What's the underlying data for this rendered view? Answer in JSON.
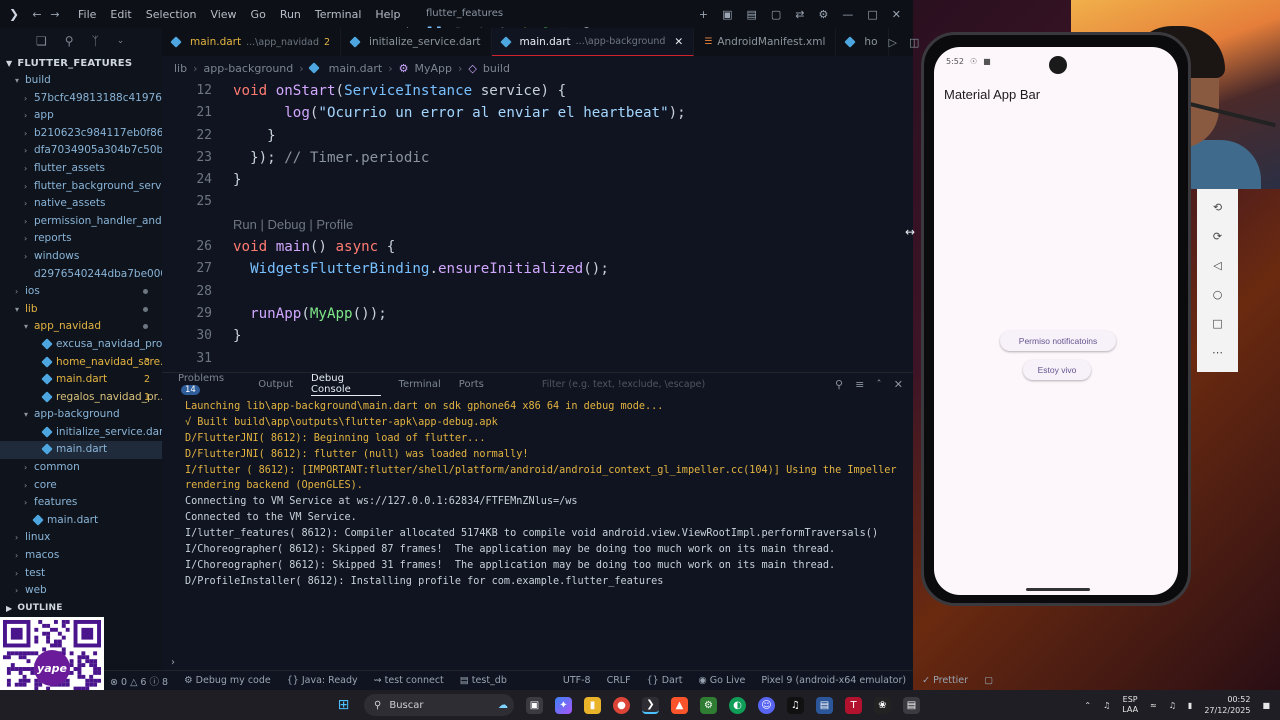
{
  "window": {
    "title": "flutter_features",
    "menu": [
      "File",
      "Edit",
      "Selection",
      "View",
      "Go",
      "Run",
      "Terminal",
      "Help"
    ]
  },
  "sidebar": {
    "section_title": "FLUTTER_FEATURES",
    "items": [
      {
        "label": "build",
        "kind": "folder",
        "open": true,
        "depth": 1,
        "color": "folder"
      },
      {
        "label": "57bcfc49813188c419766...",
        "kind": "folder",
        "depth": 2,
        "color": "folder"
      },
      {
        "label": "app",
        "kind": "folder",
        "depth": 2,
        "color": "folder"
      },
      {
        "label": "b210623c984117eb0f86f3...",
        "kind": "folder",
        "depth": 2,
        "color": "folder"
      },
      {
        "label": "dfa7034905a304b7c50be...",
        "kind": "folder",
        "depth": 2,
        "color": "folder"
      },
      {
        "label": "flutter_assets",
        "kind": "folder",
        "depth": 2,
        "color": "folder"
      },
      {
        "label": "flutter_background_servic...",
        "kind": "folder",
        "depth": 2,
        "color": "folder"
      },
      {
        "label": "native_assets",
        "kind": "folder",
        "depth": 2,
        "color": "folder"
      },
      {
        "label": "permission_handler_andr...",
        "kind": "folder",
        "depth": 2,
        "color": "folder"
      },
      {
        "label": "reports",
        "kind": "folder",
        "depth": 2,
        "color": "folder"
      },
      {
        "label": "windows",
        "kind": "folder",
        "depth": 2,
        "color": "folder"
      },
      {
        "label": "d2976540244dba7be000c...",
        "kind": "file",
        "depth": 2,
        "color": "folder"
      },
      {
        "label": "ios",
        "kind": "folder",
        "depth": 1,
        "color": "folder",
        "dot": true
      },
      {
        "label": "lib",
        "kind": "folder",
        "open": true,
        "depth": 1,
        "color": "warn",
        "dot": true
      },
      {
        "label": "app_navidad",
        "kind": "folder",
        "open": true,
        "depth": 2,
        "color": "warn",
        "dot": true
      },
      {
        "label": "excusa_navidad_provide...",
        "kind": "dart",
        "depth": 3,
        "color": "folder"
      },
      {
        "label": "home_navidad_scre...",
        "kind": "dart",
        "depth": 3,
        "color": "warn",
        "badge": "3"
      },
      {
        "label": "main.dart",
        "kind": "dart",
        "depth": 3,
        "color": "warn",
        "badge": "2"
      },
      {
        "label": "regalos_navidad_pr...",
        "kind": "dart",
        "depth": 3,
        "color": "mod",
        "badge": "1"
      },
      {
        "label": "app-background",
        "kind": "folder",
        "open": true,
        "depth": 2,
        "color": "folder"
      },
      {
        "label": "initialize_service.dart",
        "kind": "dart",
        "depth": 3,
        "color": "folder"
      },
      {
        "label": "main.dart",
        "kind": "dart",
        "depth": 3,
        "color": "folder",
        "active": true
      },
      {
        "label": "common",
        "kind": "folder",
        "depth": 2,
        "color": "folder"
      },
      {
        "label": "core",
        "kind": "folder",
        "depth": 2,
        "color": "folder"
      },
      {
        "label": "features",
        "kind": "folder",
        "depth": 2,
        "color": "folder"
      },
      {
        "label": "main.dart",
        "kind": "dart",
        "depth": 2,
        "color": "folder"
      },
      {
        "label": "linux",
        "kind": "folder",
        "depth": 1,
        "color": "folder"
      },
      {
        "label": "macos",
        "kind": "folder",
        "depth": 1,
        "color": "folder"
      },
      {
        "label": "test",
        "kind": "folder",
        "depth": 1,
        "color": "folder"
      },
      {
        "label": "web",
        "kind": "folder",
        "depth": 1,
        "color": "folder"
      }
    ],
    "outline_label": "OUTLINE"
  },
  "tabs": [
    {
      "name": "main.dart",
      "desc": "...\\app_navidad",
      "count": "2"
    },
    {
      "name": "initialize_service.dart",
      "desc": "",
      "count": ""
    },
    {
      "name": "main.dart",
      "desc": "...\\app-background",
      "count": "",
      "active": true
    },
    {
      "name": "AndroidManifest.xml",
      "desc": "",
      "count": ""
    },
    {
      "name": "ho",
      "desc": "",
      "count": ""
    }
  ],
  "breadcrumb": [
    "lib",
    "app-background",
    "main.dart",
    "MyApp",
    "build"
  ],
  "editor": {
    "codelens": "Run | Debug | Profile"
  },
  "panel": {
    "tabs": [
      {
        "label": "Problems",
        "badge": "14"
      },
      {
        "label": "Output"
      },
      {
        "label": "Debug Console",
        "active": true
      },
      {
        "label": "Terminal"
      },
      {
        "label": "Ports"
      }
    ],
    "filter_placeholder": "Filter (e.g. text, !exclude, \\escape)",
    "console": [
      {
        "text": "Launching lib\\app-background\\main.dart on sdk gphone64 x86 64 in debug mode...",
        "warn": true
      },
      {
        "text": "√ Built build\\app\\outputs\\flutter-apk\\app-debug.apk",
        "warn": true
      },
      {
        "text": "D/FlutterJNI( 8612): Beginning load of flutter...",
        "warn": true
      },
      {
        "text": "D/FlutterJNI( 8612): flutter (null) was loaded normally!",
        "warn": true
      },
      {
        "text": "I/flutter ( 8612): [IMPORTANT:flutter/shell/platform/android/android_context_gl_impeller.cc(104)] Using the Impeller",
        "warn": true
      },
      {
        "text": "rendering backend (OpenGLES).",
        "warn": true
      },
      {
        "text": "Connecting to VM Service at ws://127.0.0.1:62834/FTFEMnZNlus=/ws",
        "warn": false
      },
      {
        "text": "Connected to the VM Service.",
        "warn": false
      },
      {
        "text": "I/lutter_features( 8612): Compiler allocated 5174KB to compile void android.view.ViewRootImpl.performTraversals()",
        "warn": false
      },
      {
        "text": "I/Choreographer( 8612): Skipped 87 frames!  The application may be doing too much work on its main thread.",
        "warn": false
      },
      {
        "text": "I/Choreographer( 8612): Skipped 31 frames!  The application may be doing too much work on its main thread.",
        "warn": false
      },
      {
        "text": "D/ProfileInstaller( 8612): Installing profile for com.example.flutter_features",
        "warn": false
      }
    ]
  },
  "statusbar": {
    "errors": "0",
    "warnings": "6",
    "infos": "8",
    "debug": "Debug my code",
    "java": "Java: Ready",
    "test_connect": "test connect",
    "test_db": "test_db",
    "encoding": "UTF-8",
    "eol": "CRLF",
    "language": "Dart",
    "golive": "Go Live",
    "device": "Pixel 9 (android-x64 emulator)",
    "prettier": "Prettier"
  },
  "phone": {
    "time": "5:52",
    "appbar_title": "Material App Bar",
    "btn_permission": "Permiso notificatoins",
    "btn_alive": "Estoy vivo"
  },
  "taskbar": {
    "search_label": "Buscar",
    "lang": "ESP",
    "lang_region": "LAA",
    "time": "00:52",
    "date": "27/12/2025"
  },
  "qr": {
    "brand": "yape"
  }
}
